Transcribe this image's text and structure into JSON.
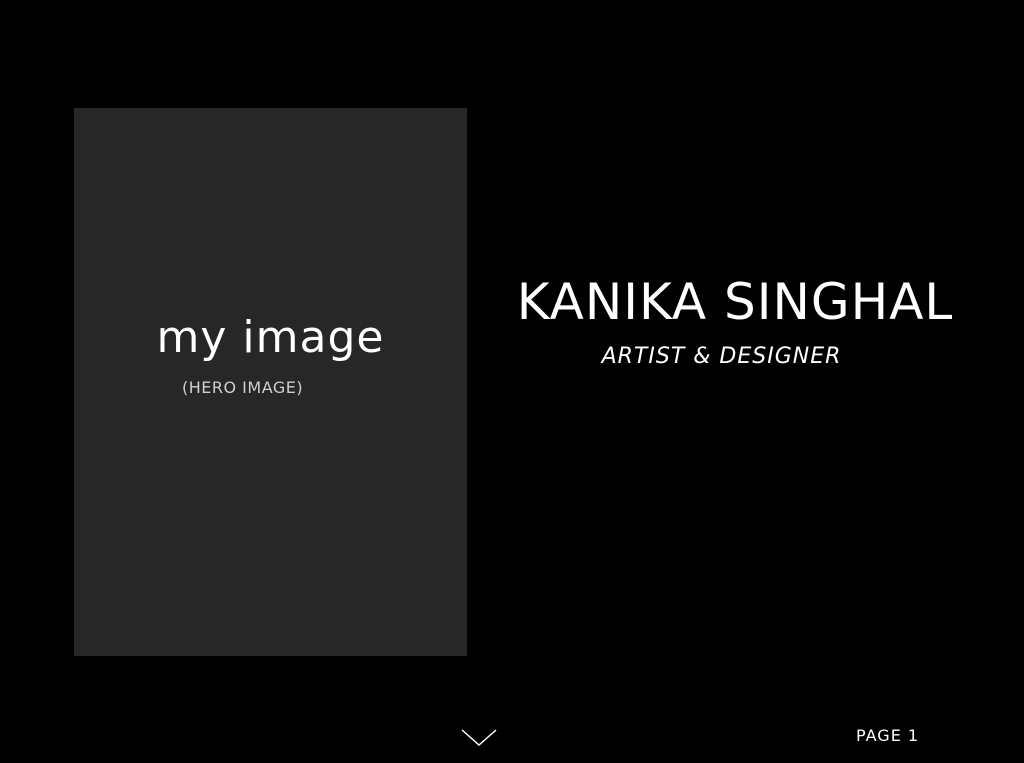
{
  "hero": {
    "main_text": "my image",
    "sub_text": "(HERO IMAGE)",
    "background_color": "#272727"
  },
  "profile": {
    "name": "KANIKA SINGHAL",
    "tagline": "ARTIST & DESIGNER"
  },
  "footer": {
    "scroll_icon": "chevron-down-icon",
    "page_label": "PAGE 1"
  },
  "colors": {
    "background": "#000000",
    "text": "#ffffff"
  }
}
